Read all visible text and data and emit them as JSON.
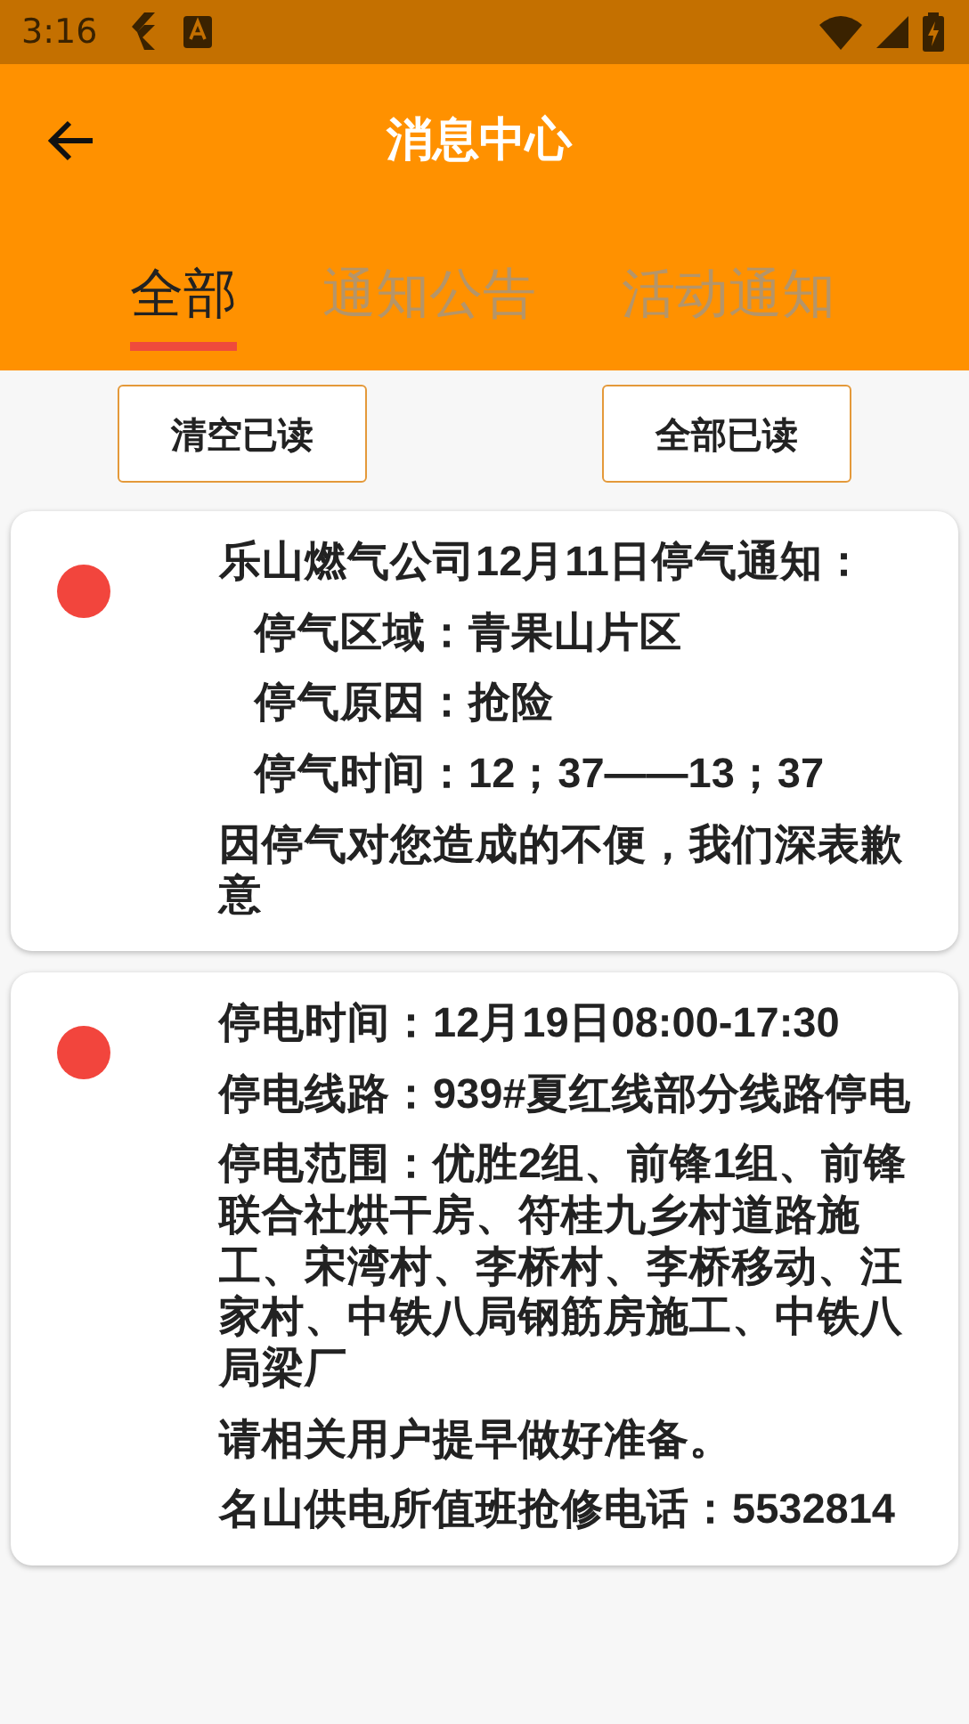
{
  "status_bar": {
    "time": "3:16"
  },
  "app_bar": {
    "title": "消息中心"
  },
  "tabs": [
    {
      "label": "全部",
      "selected": true
    },
    {
      "label": "通知公告",
      "selected": false
    },
    {
      "label": "活动通知",
      "selected": false
    }
  ],
  "actions": [
    "清空已读",
    "全部已读"
  ],
  "messages": [
    {
      "unread": true,
      "lines": [
        {
          "kind": "plain",
          "text": "乐山燃气公司12月11日停气通知："
        },
        {
          "kind": "indented",
          "text": "停气区域：青果山片区"
        },
        {
          "kind": "indented",
          "text": "停气原因：抢险"
        },
        {
          "kind": "indented",
          "text": "停气时间：12；37——13；37"
        },
        {
          "kind": "plain",
          "text": "因停气对您造成的不便，我们深表歉意"
        }
      ]
    },
    {
      "unread": true,
      "lines": [
        {
          "kind": "plain",
          "text": "停电时间：12月19日08:00-17:30"
        },
        {
          "kind": "plain",
          "text": "停电线路：939#夏红线部分线路停电"
        },
        {
          "kind": "plain",
          "text": "停电范围：优胜2组、前锋1组、前锋联合社烘干房、符桂九乡村道路施工、宋湾村、李桥村、李桥移动、汪家村、中铁八局钢筋房施工、中铁八局梁厂"
        },
        {
          "kind": "plain",
          "text": "请相关用户提早做好准备。"
        },
        {
          "kind": "plain",
          "text": "名山供电所值班抢修电话：5532814"
        }
      ]
    }
  ]
}
